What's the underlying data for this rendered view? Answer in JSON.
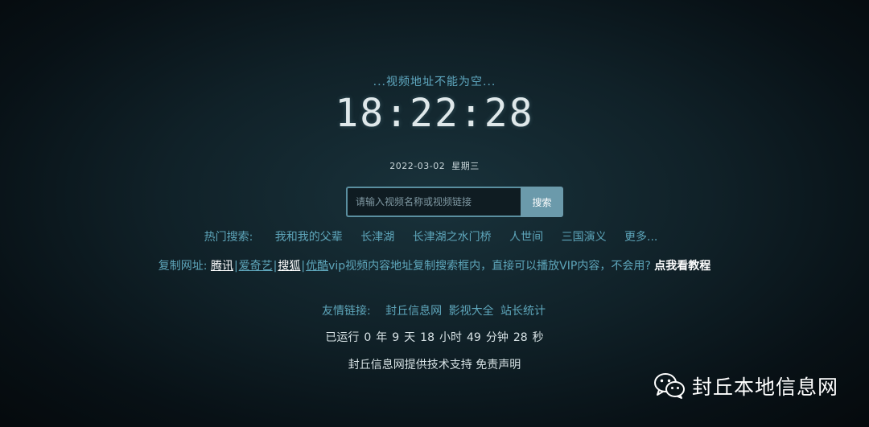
{
  "notice": "...视频地址不能为空...",
  "clock": {
    "time": "18:22:28",
    "date": "2022-03-02",
    "weekday": "星期三"
  },
  "search": {
    "placeholder": "请输入视频名称或视频链接",
    "button": "搜索"
  },
  "hot": {
    "label": "热门搜索:",
    "items": [
      "我和我的父辈",
      "长津湖",
      "长津湖之水门桥",
      "人世间",
      "三国演义",
      "更多..."
    ]
  },
  "copy": {
    "label": "复制网址:",
    "sites": [
      "腾讯",
      "爱奇艺",
      "搜狐",
      "优酷"
    ],
    "separator": "|",
    "text": "vip视频内容地址复制搜索框内，直接可以播放VIP内容，不会用?",
    "tutorial": "点我看教程"
  },
  "friends": {
    "label": "友情链接:",
    "links": [
      "封丘信息网",
      "影视大全",
      "站长统计"
    ]
  },
  "uptime": {
    "prefix": "已运行",
    "years": "0",
    "years_unit": "年",
    "days": "9",
    "days_unit": "天",
    "hours": "18",
    "hours_unit": "小时",
    "minutes": "49",
    "minutes_unit": "分钟",
    "seconds": "28",
    "seconds_unit": "秒"
  },
  "footer": {
    "support": "封丘信息网提供技术支持",
    "disclaimer": "免责声明"
  },
  "watermark": {
    "icon": "wechat-icon",
    "text": "封丘本地信息网"
  }
}
